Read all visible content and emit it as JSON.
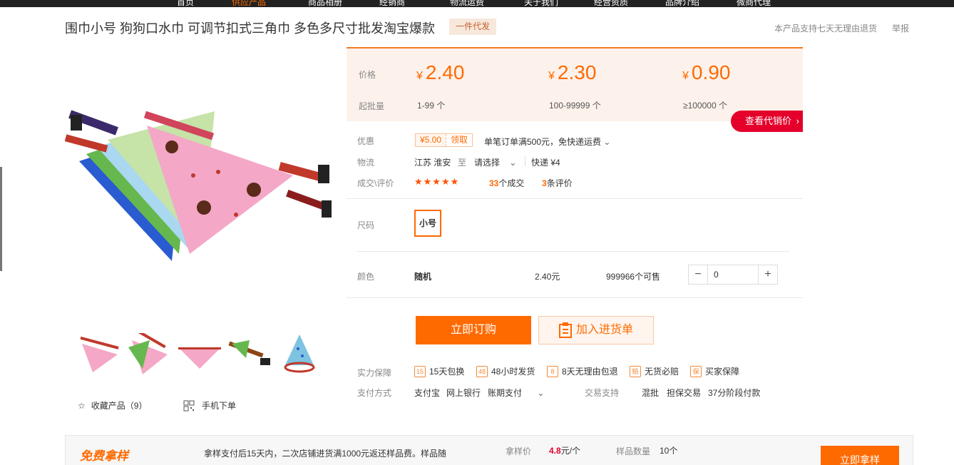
{
  "topnav": [
    "首页",
    "供应产品",
    "商品相册",
    "经销商",
    "物流运费",
    "关于我们",
    "经营资质",
    "品牌介绍",
    "微商代理"
  ],
  "product": {
    "title": "围巾小号 狗狗口水巾 可调节扣式三角巾 多色多尺寸批发淘宝爆款",
    "dropship_badge": "一件代发",
    "return_note": "本产品支持七天无理由退货",
    "report": "举报"
  },
  "price_box": {
    "price_label": "价格",
    "moq_label": "起批量",
    "tiers": [
      {
        "currency": "¥",
        "price": "2.40",
        "qty": "1-99 个"
      },
      {
        "currency": "¥",
        "price": "2.30",
        "qty": "100-99999 个"
      },
      {
        "currency": "¥",
        "price": "0.90",
        "qty": "≥100000 个"
      }
    ],
    "agent_price_button": "查看代销价"
  },
  "promo": {
    "label": "优惠",
    "coupon_amount": "¥5.00",
    "coupon_action": "领取",
    "text": "单笔订单满500元，免快递运费"
  },
  "logistics": {
    "label": "物流",
    "from": "江苏 淮安",
    "to_word": "至",
    "to_select": "请选择",
    "express": "快递 ¥4"
  },
  "reviews": {
    "label": "成交\\评价",
    "stars": "★★★★★",
    "deals_count": "33",
    "deals_suffix": "个成交",
    "review_count": "3",
    "review_suffix": "条评价"
  },
  "size": {
    "label": "尺码",
    "option": "小号"
  },
  "color": {
    "label": "颜色",
    "option": "随机",
    "unit_price": "2.40元",
    "stock": "999966个可售",
    "quantity": "0"
  },
  "actions": {
    "buy": "立即订购",
    "add_to_cart": "加入进货单"
  },
  "guarantees": {
    "label": "实力保障",
    "items": [
      {
        "icon": "15",
        "text": "15天包换"
      },
      {
        "icon": "48",
        "text": "48小时发货"
      },
      {
        "icon": "8",
        "text": "8天无理由包退"
      },
      {
        "icon": "赔",
        "text": "无货必赔"
      },
      {
        "icon": "保",
        "text": "买家保障"
      }
    ]
  },
  "payment": {
    "label": "支付方式",
    "methods": [
      "支付宝",
      "网上银行",
      "账期支付"
    ],
    "trade_label": "交易支持",
    "trade_items": [
      "混批",
      "担保交易",
      "37分阶段付款"
    ]
  },
  "gallery": {
    "favorite_label": "收藏产品（9）",
    "mobile_label": "手机下单"
  },
  "sample": {
    "title": "免费拿样",
    "description": "拿样支付后15天内，二次店铺进货满1000元返还样品费。样品随",
    "price_label": "拿样价",
    "price_value": "4.8",
    "price_unit": "元/个",
    "count_label": "样品数量",
    "count_value": "10个",
    "button": "立即拿样"
  },
  "colors": {
    "accent": "#ff6a00",
    "price_bg": "#fdf2eb",
    "red_button": "#e4002b"
  }
}
